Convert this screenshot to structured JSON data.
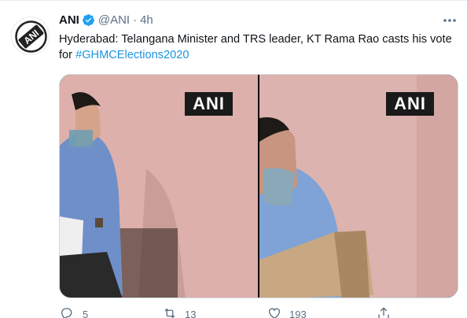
{
  "author": {
    "name": "ANI",
    "handle": "@ANI",
    "separator": "·",
    "time": "4h",
    "avatar_text": "ANI"
  },
  "tweet": {
    "text": "Hyderabad: Telangana Minister and TRS leader, KT Rama Rao casts his vote for ",
    "hashtag": "#GHMCElections2020"
  },
  "media": {
    "left_badge": "ANI",
    "right_badge": "ANI"
  },
  "actions": {
    "reply_count": "5",
    "retweet_count": "13",
    "like_count": "193"
  },
  "colors": {
    "link": "#1b95e0",
    "muted": "#5b7083",
    "verified": "#1da1f2"
  },
  "icons": [
    "verified-badge-icon",
    "more-icon",
    "reply-icon",
    "retweet-icon",
    "like-icon",
    "share-icon"
  ]
}
